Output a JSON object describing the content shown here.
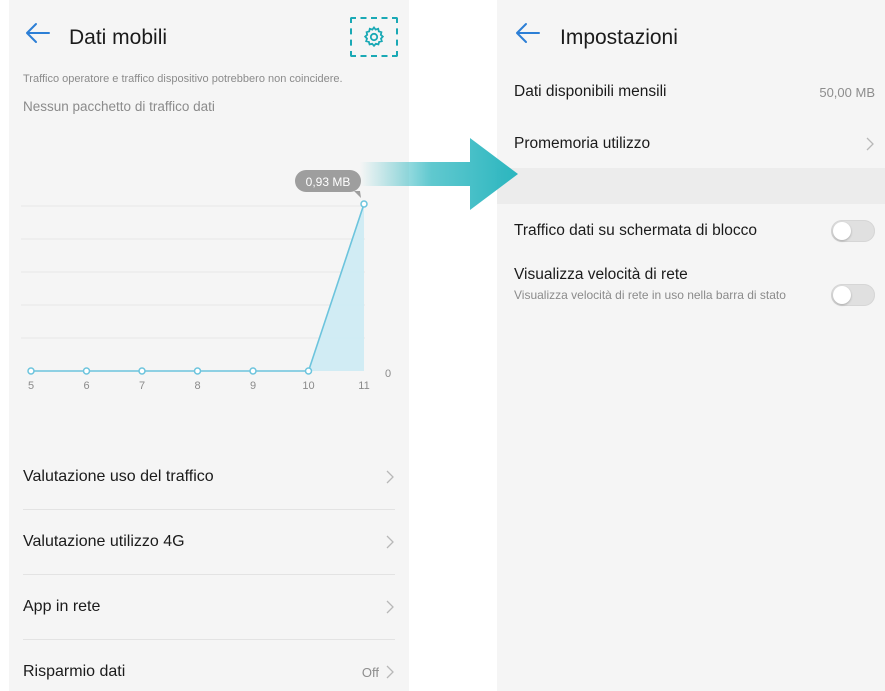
{
  "left_screen": {
    "title": "Dati mobili",
    "note": "Traffico operatore e traffico dispositivo potrebbero non coincidere.",
    "subtitle": "Nessun pacchetto di traffico dati",
    "rows": [
      {
        "label": "Valutazione uso del traffico",
        "value": ""
      },
      {
        "label": "Valutazione utilizzo 4G",
        "value": ""
      },
      {
        "label": "App in rete",
        "value": ""
      },
      {
        "label": "Risparmio dati",
        "value": "Off"
      }
    ]
  },
  "chart_data": {
    "type": "area",
    "x": [
      "5",
      "6",
      "7",
      "8",
      "9",
      "10",
      "11"
    ],
    "values": [
      0,
      0,
      0,
      0,
      0,
      0,
      0.93
    ],
    "callout": "0,93 MB",
    "y_tick_labels": [
      "0"
    ],
    "grid": true,
    "colors": {
      "line": "#6cc4dd",
      "fill": "#cdebf4",
      "callout_bg": "#9e9e9e"
    }
  },
  "right_screen": {
    "title": "Impostazioni",
    "monthly_label": "Dati disponibili mensili",
    "monthly_value": "50,00 MB",
    "reminder_label": "Promemoria utilizzo",
    "lockscreen_label": "Traffico dati su schermata di blocco",
    "lockscreen_on": false,
    "speed_label": "Visualizza velocità di rete",
    "speed_desc": "Visualizza velocità di rete in uso nella barra di stato",
    "speed_on": false
  },
  "icons": {
    "back": "arrow-left-icon",
    "gear": "gear-icon",
    "chevron": "chevron-right-icon",
    "transition_arrow": "big-arrow-right-icon"
  },
  "colors": {
    "accent": "#1aa9b5",
    "back_arrow": "#2c7fd6"
  }
}
